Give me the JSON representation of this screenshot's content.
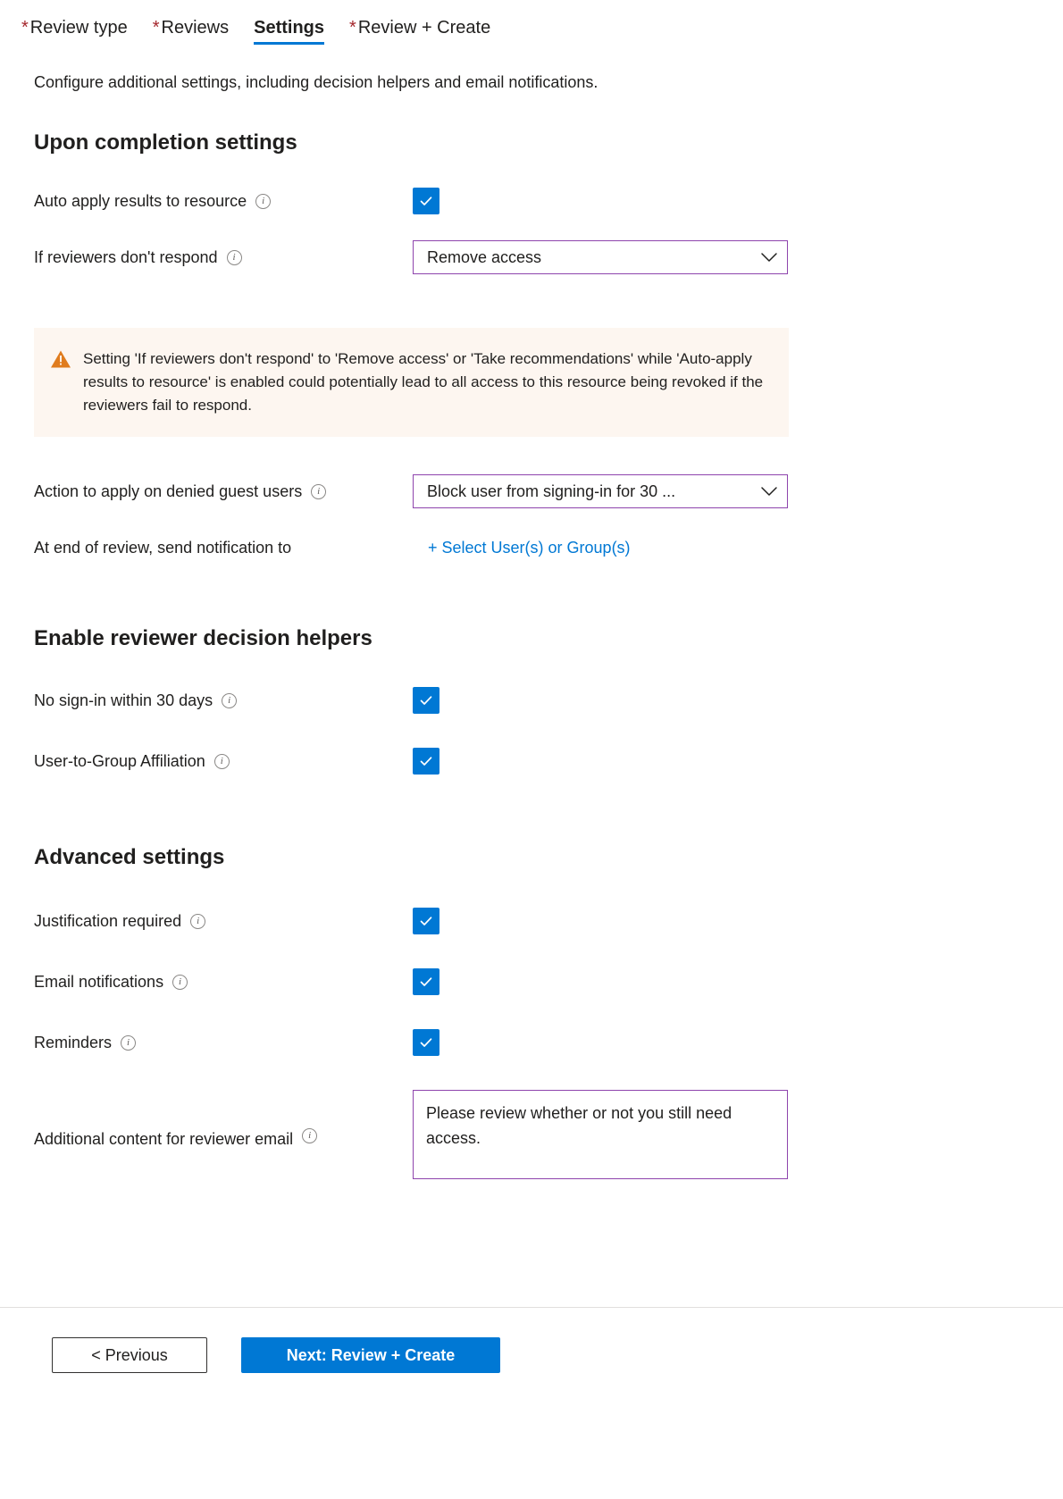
{
  "tabs": [
    {
      "label": "Review type",
      "required": true,
      "active": false
    },
    {
      "label": "Reviews",
      "required": true,
      "active": false
    },
    {
      "label": "Settings",
      "required": false,
      "active": true
    },
    {
      "label": "Review + Create",
      "required": true,
      "active": false
    }
  ],
  "intro": "Configure additional settings, including decision helpers and email notifications.",
  "upon_completion": {
    "title": "Upon completion settings",
    "auto_apply_label": "Auto apply results to resource",
    "auto_apply_checked": true,
    "no_respond_label": "If reviewers don't respond",
    "no_respond_value": "Remove access",
    "warning": "Setting 'If reviewers don't respond' to 'Remove access' or 'Take recommendations' while 'Auto-apply results to resource' is enabled could potentially lead to all access to this resource being revoked if the reviewers fail to respond.",
    "denied_guest_label": "Action to apply on denied guest users",
    "denied_guest_value": "Block user from signing-in for 30 ...",
    "notify_label": "At end of review, send notification to",
    "notify_link": "+ Select User(s) or Group(s)"
  },
  "decision_helpers": {
    "title": "Enable reviewer decision helpers",
    "items": [
      {
        "label": "No sign-in within 30 days",
        "checked": true
      },
      {
        "label": "User-to-Group Affiliation",
        "checked": true
      }
    ]
  },
  "advanced": {
    "title": "Advanced settings",
    "items": [
      {
        "label": "Justification required",
        "checked": true
      },
      {
        "label": "Email notifications",
        "checked": true
      },
      {
        "label": "Reminders",
        "checked": true
      }
    ],
    "additional_content_label": "Additional content for reviewer email",
    "additional_content_value": "Please review whether or not you still need access."
  },
  "footer": {
    "previous_label": "< Previous",
    "next_label": "Next: Review + Create"
  },
  "icons": {
    "info": "i",
    "warning": "warning-triangle-icon",
    "chevron": "chevron-down-icon",
    "check": "checkmark-icon"
  },
  "colors": {
    "accent": "#0078d4",
    "required": "#a4262c",
    "dropdown_border": "#8e44ad",
    "warning_bg": "#fdf6f0",
    "warning_icon": "#e07c1e"
  }
}
